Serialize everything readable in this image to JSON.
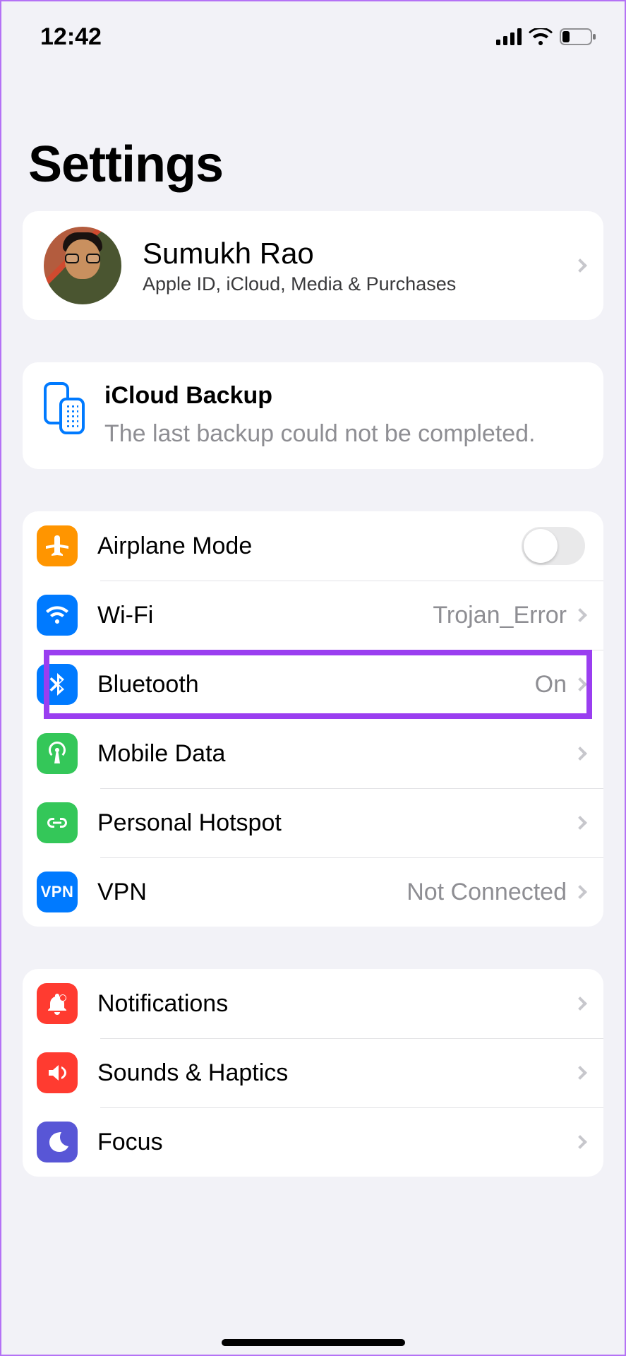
{
  "status": {
    "time": "12:42"
  },
  "title": "Settings",
  "profile": {
    "name": "Sumukh Rao",
    "subtitle": "Apple ID, iCloud, Media & Purchases"
  },
  "icloud": {
    "title": "iCloud Backup",
    "message": "The last backup could not be completed."
  },
  "network": {
    "airplane": {
      "label": "Airplane Mode"
    },
    "wifi": {
      "label": "Wi-Fi",
      "value": "Trojan_Error"
    },
    "bluetooth": {
      "label": "Bluetooth",
      "value": "On"
    },
    "mobile": {
      "label": "Mobile Data"
    },
    "hotspot": {
      "label": "Personal Hotspot"
    },
    "vpn": {
      "label": "VPN",
      "value": "Not Connected",
      "badge": "VPN"
    }
  },
  "general": {
    "notifications": {
      "label": "Notifications"
    },
    "sounds": {
      "label": "Sounds & Haptics"
    },
    "focus": {
      "label": "Focus"
    }
  }
}
